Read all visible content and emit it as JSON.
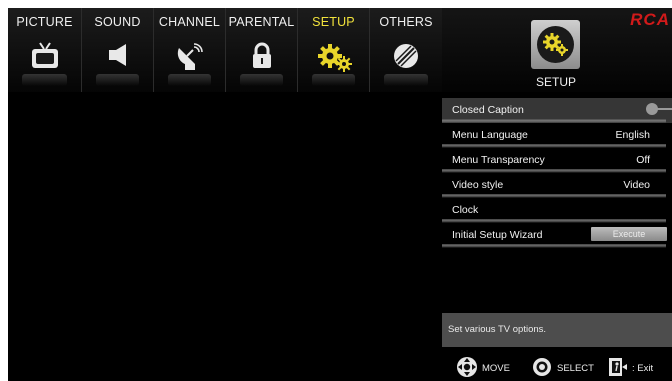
{
  "tabs": [
    {
      "label": "PICTURE",
      "icon": "tv-icon",
      "active": false
    },
    {
      "label": "SOUND",
      "icon": "speaker-icon",
      "active": false
    },
    {
      "label": "CHANNEL",
      "icon": "satellite-dish-icon",
      "active": false
    },
    {
      "label": "PARENTAL",
      "icon": "padlock-icon",
      "active": false
    },
    {
      "label": "SETUP",
      "icon": "gears-icon",
      "active": true
    },
    {
      "label": "OTHERS",
      "icon": "others-icon",
      "active": false
    }
  ],
  "header": {
    "brand": "RCA",
    "current_section": "SETUP",
    "current_icon": "gears-icon"
  },
  "menu": {
    "items": [
      {
        "label": "Closed Caption",
        "value": "",
        "control": "toggle"
      },
      {
        "label": "Menu Language",
        "value": "English"
      },
      {
        "label": "Menu Transparency",
        "value": "Off"
      },
      {
        "label": "Video style",
        "value": "Video"
      },
      {
        "label": "Clock",
        "value": ""
      },
      {
        "label": "Initial Setup Wizard",
        "value": "",
        "button": "Execute"
      }
    ]
  },
  "help_text": "Set various TV options.",
  "legend": [
    {
      "icon": "dpad-icon",
      "label": "MOVE"
    },
    {
      "icon": "ok-button-icon",
      "label": "SELECT"
    },
    {
      "icon": "exit-door-icon",
      "label": ": Exit"
    }
  ],
  "colors": {
    "active_tab_text": "#f1e23c",
    "brand_red": "#d11a1a",
    "selected_row": "#363636",
    "help_bar": "#4d4d4d"
  }
}
